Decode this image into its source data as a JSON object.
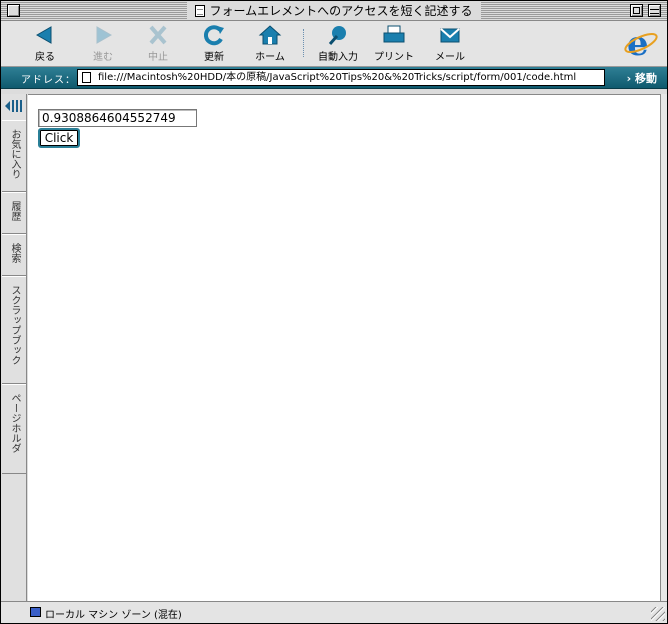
{
  "window": {
    "title": "フォームエレメントへのアクセスを短く記述する"
  },
  "toolbar": {
    "buttons": [
      {
        "label": "戻る",
        "icon": "back-arrow-icon",
        "enabled": true
      },
      {
        "label": "進む",
        "icon": "forward-arrow-icon",
        "enabled": false
      },
      {
        "label": "中止",
        "icon": "stop-icon",
        "enabled": false
      },
      {
        "label": "更新",
        "icon": "refresh-icon",
        "enabled": true
      },
      {
        "label": "ホーム",
        "icon": "home-icon",
        "enabled": true
      },
      {
        "label": "自動入力",
        "icon": "autofill-icon",
        "enabled": true
      },
      {
        "label": "プリント",
        "icon": "printer-icon",
        "enabled": true
      },
      {
        "label": "メール",
        "icon": "mail-icon",
        "enabled": true
      }
    ]
  },
  "address": {
    "label": "アドレス：",
    "url": "file:///Macintosh%20HDD/本の原稿/JavaScript%20Tips%20&%20Tricks/script/form/001/code.html",
    "go_label": "移動"
  },
  "sidebar": {
    "tabs": [
      "お気に入り",
      "履歴",
      "検索",
      "スクラップブック",
      "ページホルダ"
    ]
  },
  "page": {
    "random_value": "0.9308864604552749",
    "button_label": "Click"
  },
  "status": {
    "zone_text": "ローカル マシン ゾーン (混在)"
  },
  "colors": {
    "accent": "#1f6f86",
    "ie_blue": "#1a6fc4"
  }
}
